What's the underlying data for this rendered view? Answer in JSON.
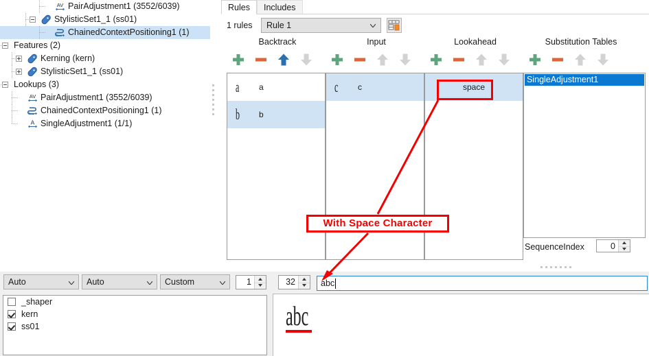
{
  "tree": {
    "items": [
      {
        "label": "PairAdjustment1 (3552/6039)",
        "indent": 3,
        "icon": "av-icon",
        "expander": "none",
        "selected": false
      },
      {
        "label": "StylisticSet1_1 (ss01)",
        "indent": 2,
        "icon": "tag-icon",
        "expander": "minus",
        "selected": false
      },
      {
        "label": "ChainedContextPositioning1 (1)",
        "indent": 3,
        "icon": "chain-icon",
        "expander": "none",
        "selected": true
      },
      {
        "label": "Features (2)",
        "indent": 0,
        "icon": "none",
        "expander": "minus",
        "selected": false
      },
      {
        "label": "Kerning (kern)",
        "indent": 1,
        "icon": "tag-icon",
        "expander": "plus",
        "selected": false
      },
      {
        "label": "StylisticSet1_1 (ss01)",
        "indent": 1,
        "icon": "tag-icon",
        "expander": "plus",
        "selected": false
      },
      {
        "label": "Lookups (3)",
        "indent": 0,
        "icon": "none",
        "expander": "minus",
        "selected": false
      },
      {
        "label": "PairAdjustment1 (3552/6039)",
        "indent": 1,
        "icon": "av-icon",
        "expander": "none",
        "selected": false
      },
      {
        "label": "ChainedContextPositioning1 (1)",
        "indent": 1,
        "icon": "chain-icon",
        "expander": "none",
        "selected": false
      },
      {
        "label": "SingleAdjustment1 (1/1)",
        "indent": 1,
        "icon": "a-icon",
        "expander": "none",
        "selected": false
      }
    ]
  },
  "rules_panel": {
    "tabs": [
      {
        "label": "Rules",
        "active": true
      },
      {
        "label": "Includes",
        "active": false
      }
    ],
    "rules_count_label": "1 rules",
    "rule_selector": {
      "value": "Rule 1"
    },
    "grid_button_name": "rule-table-button",
    "columns": [
      {
        "title": "Backtrack"
      },
      {
        "title": "Input"
      },
      {
        "title": "Lookahead"
      },
      {
        "title": "Substitution Tables"
      }
    ],
    "backtrack_items": [
      {
        "glyph": "a",
        "name": "a",
        "highlighted": false
      },
      {
        "glyph": "b",
        "name": "b",
        "highlighted": true
      }
    ],
    "input_items": [
      {
        "glyph": "c",
        "name": "c",
        "highlighted": true
      }
    ],
    "lookahead_items": [
      {
        "name": "space",
        "highlighted": true
      }
    ],
    "substitution_items": [
      {
        "name": "SingleAdjustment1",
        "selected": true
      }
    ],
    "sequence_index": {
      "label": "SequenceIndex",
      "value": "0"
    }
  },
  "bottom": {
    "dropdowns": [
      {
        "value": "Auto"
      },
      {
        "value": "Auto"
      },
      {
        "value": "Custom"
      }
    ],
    "spinners": [
      {
        "value": "1"
      },
      {
        "value": "32"
      }
    ],
    "text_input": {
      "value": "abc "
    },
    "features": [
      {
        "label": "_shaper",
        "checked": false
      },
      {
        "label": "kern",
        "checked": true
      },
      {
        "label": "ss01",
        "checked": true
      }
    ],
    "preview_text": "abc"
  },
  "annotation": {
    "label": "With Space Character",
    "color": "#f50000"
  },
  "colors": {
    "selection_blue": "#0b78d1",
    "tree_selection": "#cce3f7",
    "list_highlight": "#cfe3f5",
    "plus_green": "#5fa37f",
    "minus_orange": "#d9663d",
    "arrow_active": "#2b6fad",
    "arrow_disabled": "#d2d2d2",
    "annotation_red": "#f50000"
  }
}
